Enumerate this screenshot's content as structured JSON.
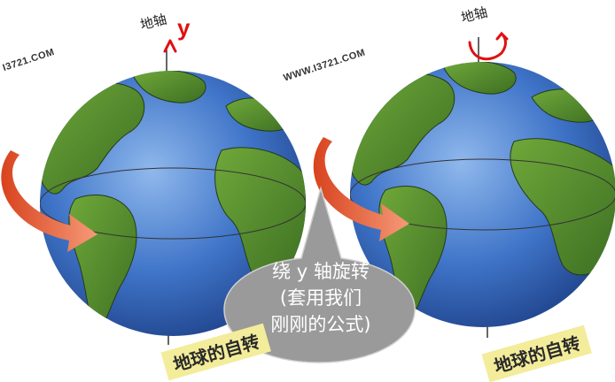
{
  "left_globe": {
    "axis_label": "地轴",
    "axis_variable": "y",
    "watermark": "I3721.COM",
    "caption": "地球的自转"
  },
  "right_globe": {
    "axis_label": "地轴",
    "watermark": "WWW.I3721.COM",
    "caption": "地球的自转"
  },
  "callout": {
    "line1": "绕 y 轴旋转",
    "line2": "(套用我们",
    "line3": "刚刚的公式)"
  },
  "colors": {
    "ocean": "#3f74c8",
    "land": "#4f8a2c",
    "arrow": "#e0572a",
    "annotation_red": "#e01010",
    "callout_bubble": "#9a9a9a",
    "caption_bg": "#f3ec9a"
  }
}
